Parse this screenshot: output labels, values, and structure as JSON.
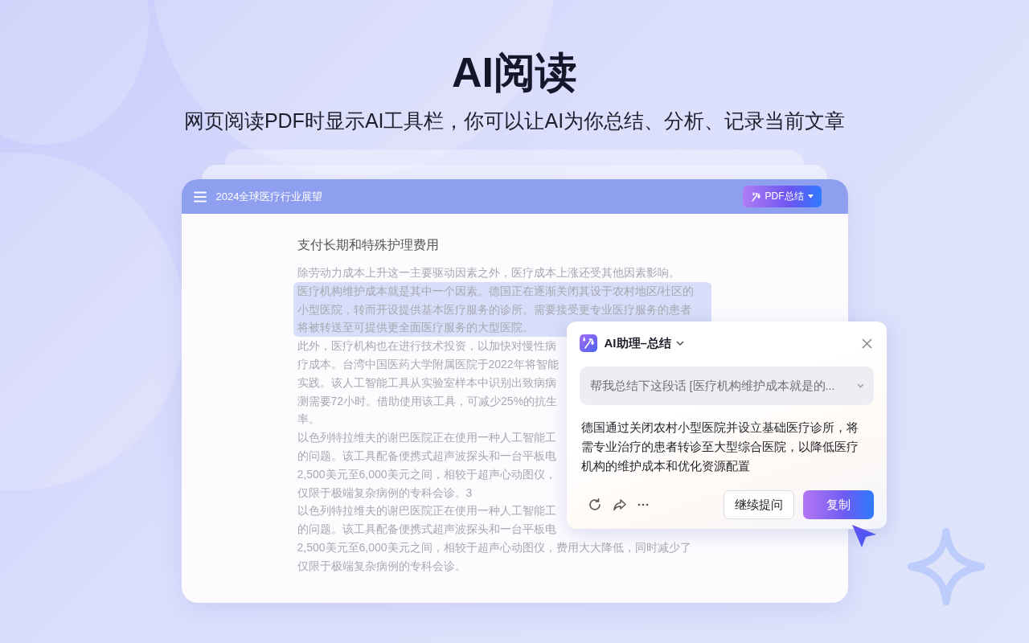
{
  "hero": {
    "title": "AI阅读",
    "subtitle": "网页阅读PDF时显示AI工具栏，你可以让AI为你总结、分析、记录当前文章"
  },
  "document": {
    "title": "2024全球医疗行业展望",
    "summary_button": {
      "label": "PDF总结"
    },
    "heading": "支付长期和特殊护理费用",
    "lines": [
      {
        "text": "除劳动力成本上升这一主要驱动因素之外，医疗成本上涨还受其他因素影响。",
        "highlighted": false
      },
      {
        "text": "医疗机构维护成本就是其中一个因素。德国正在逐渐关闭其设于农村地区/社区的",
        "highlighted": true
      },
      {
        "text": "小型医院，转而开设提供基本医疗服务的诊所。需要接受更专业医疗服务的患者",
        "highlighted": true
      },
      {
        "text": "将被转送至可提供更全面医疗服务的大型医院。",
        "highlighted": true
      },
      {
        "text": "此外，医疗机构也在进行技术投资，以加快对慢性病",
        "highlighted": false
      },
      {
        "text": "疗成本。台湾中国医药大学附属医院于2022年将智能",
        "highlighted": false
      },
      {
        "text": "实践。该人工智能工具从实验室样本中识别出致病病",
        "highlighted": false
      },
      {
        "text": "测需要72小时。借助使用该工具，可减少25%的抗生",
        "highlighted": false
      },
      {
        "text": "率。",
        "highlighted": false
      },
      {
        "text": "以色列特拉维夫的谢巴医院正在使用一种人工智能工",
        "highlighted": false
      },
      {
        "text": "的问题。该工具配备便携式超声波探头和一台平板电",
        "highlighted": false
      },
      {
        "text": "2,500美元至6,000美元之间，相较于超声心动图仪，",
        "highlighted": false
      },
      {
        "text": "仅限于极端复杂病例的专科会诊。3",
        "highlighted": false
      },
      {
        "text": "以色列特拉维夫的谢巴医院正在使用一种人工智能工",
        "highlighted": false
      },
      {
        "text": "的问题。该工具配备便携式超声波探头和一台平板电",
        "highlighted": false
      },
      {
        "text": "2,500美元至6,000美元之间，相较于超声心动图仪，费用大大降低，同时减少了",
        "highlighted": false
      },
      {
        "text": "仅限于极端复杂病例的专科会诊。",
        "highlighted": false
      }
    ]
  },
  "assistant": {
    "title": "AI助理–总结",
    "prompt": "帮我总结下这段话 [医疗机构维护成本就是的...",
    "answer": "德国通过关闭农村小型医院并设立基础医疗诊所，将需专业治疗的患者转诊至大型综合医院，以降低医疗机构的维护成本和优化资源配置",
    "buttons": [
      {
        "label": "继续提问",
        "kind": "secondary"
      },
      {
        "label": "复制",
        "kind": "primary"
      }
    ]
  }
}
